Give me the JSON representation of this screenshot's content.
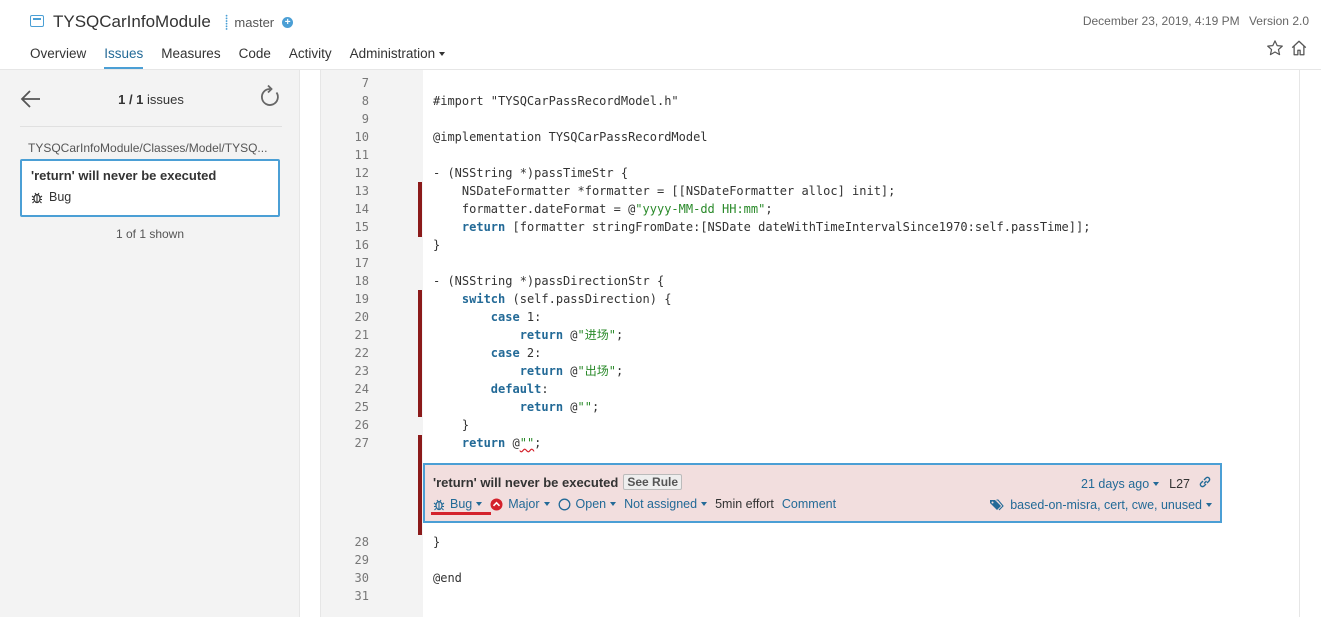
{
  "header": {
    "project_name": "TYSQCarInfoModule",
    "branch": "master",
    "date": "December 23, 2019, 4:19 PM",
    "version": "Version 2.0",
    "nav": [
      "Overview",
      "Issues",
      "Measures",
      "Code",
      "Activity",
      "Administration"
    ]
  },
  "sidebar": {
    "count_current": "1 / 1",
    "count_label": "issues",
    "path": "TYSQCarInfoModule/Classes/Model/TYSQ...",
    "issue_title": "'return' will never be executed",
    "issue_type": "Bug",
    "shown": "1 of 1 shown"
  },
  "code": {
    "lines": [
      {
        "n": "7",
        "t": ""
      },
      {
        "n": "8",
        "t": "#import \"TYSQCarPassRecordModel.h\""
      },
      {
        "n": "9",
        "t": ""
      },
      {
        "n": "10",
        "t": "@implementation TYSQCarPassRecordModel"
      },
      {
        "n": "11",
        "t": ""
      },
      {
        "n": "12",
        "t": "- (NSString *)passTimeStr {"
      },
      {
        "n": "13",
        "t": "    NSDateFormatter *formatter = [[NSDateFormatter alloc] init];"
      },
      {
        "n": "14",
        "t": "    formatter.dateFormat = @"
      },
      {
        "n": "15",
        "t": "    "
      },
      {
        "n": "16",
        "t": "}"
      },
      {
        "n": "17",
        "t": ""
      },
      {
        "n": "18",
        "t": "- (NSString *)passDirectionStr {"
      },
      {
        "n": "19",
        "t": "    "
      },
      {
        "n": "20",
        "t": "        "
      },
      {
        "n": "21",
        "t": "            "
      },
      {
        "n": "22",
        "t": "        "
      },
      {
        "n": "23",
        "t": "            "
      },
      {
        "n": "24",
        "t": "        "
      },
      {
        "n": "25",
        "t": "            "
      },
      {
        "n": "26",
        "t": "    }"
      },
      {
        "n": "27",
        "t": "    "
      },
      {
        "n": "28",
        "t": "}"
      },
      {
        "n": "29",
        "t": ""
      },
      {
        "n": "30",
        "t": "@end"
      },
      {
        "n": "31",
        "t": ""
      }
    ],
    "l14_str": "\"yyyy-MM-dd HH:mm\"",
    "l14_end": ";",
    "l15_kw": "return",
    "l15_rest": " [formatter stringFromDate:[NSDate dateWithTimeIntervalSince1970:self.passTime]];",
    "l19_kw": "switch",
    "l19_rest": " (self.passDirection) {",
    "l20_kw": "case",
    "l20_rest": " 1:",
    "l21_kw": "return",
    "l21_at": " @",
    "l21_str": "\"进场\"",
    "l21_end": ";",
    "l22_kw": "case",
    "l22_rest": " 2:",
    "l23_kw": "return",
    "l23_at": " @",
    "l23_str": "\"出场\"",
    "l23_end": ";",
    "l24_kw": "default",
    "l24_rest": ":",
    "l25_kw": "return",
    "l25_at": " @",
    "l25_str": "\"\"",
    "l25_end": ";",
    "l27_kw": "return",
    "l27_at": " @",
    "l27_str": "\"\"",
    "l27_end": ";"
  },
  "issue": {
    "message": "'return' will never be executed",
    "see_rule": "See Rule",
    "age": "21 days ago",
    "line": "L27",
    "type": "Bug",
    "severity": "Major",
    "status": "Open",
    "assignee": "Not assigned",
    "effort": "5min effort",
    "comment": "Comment",
    "tags": "based-on-misra, cert, cwe, unused"
  },
  "colors": {
    "accent": "#4b9fd5",
    "issue_bg": "#f2dede",
    "marker": "#8b1a1a",
    "severity": "#d4222c"
  }
}
